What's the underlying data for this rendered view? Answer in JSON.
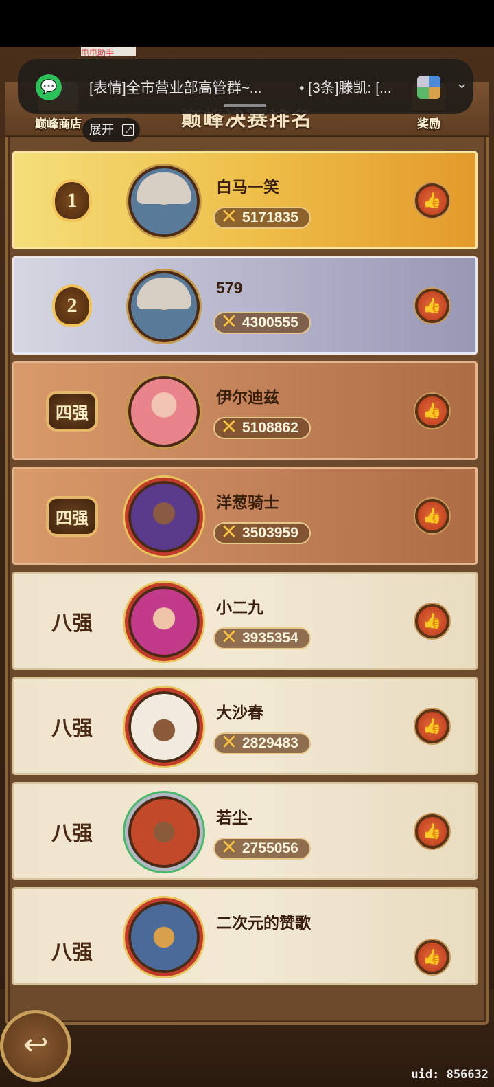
{
  "notification": {
    "title": "[表情]全市营业部高管群~...",
    "detail": "• [3条]滕凯: [...",
    "expand_label": "展开",
    "top_strip": "电电助手"
  },
  "header": {
    "title": "巅峰决赛排名",
    "shop_label": "巅峰商店",
    "reward_label": "奖励"
  },
  "rankings": [
    {
      "rank": "1",
      "name": "白马一笑",
      "score": "5171835",
      "tier": "gold"
    },
    {
      "rank": "2",
      "name": "579",
      "score": "4300555",
      "tier": "silver"
    },
    {
      "rank": "四强",
      "name": "伊尔迪兹",
      "score": "5108862",
      "tier": "bronze"
    },
    {
      "rank": "四强",
      "name": "洋葱骑士",
      "score": "3503959",
      "tier": "bronze"
    },
    {
      "rank": "八强",
      "name": "小二九",
      "score": "3935354",
      "tier": "plain"
    },
    {
      "rank": "八强",
      "name": "大沙春",
      "score": "2829483",
      "tier": "plain"
    },
    {
      "rank": "八强",
      "name": "若尘-",
      "score": "2755056",
      "tier": "plain"
    },
    {
      "rank": "八强",
      "name": "二次元的赞歌",
      "score": "",
      "tier": "plain"
    }
  ],
  "footer": {
    "uid": "uid: 856632"
  },
  "icons": {
    "like": "thumbs-up-icon",
    "score": "crossed-swords-icon",
    "back": "return-arrow-icon",
    "wechat": "wechat-icon"
  }
}
